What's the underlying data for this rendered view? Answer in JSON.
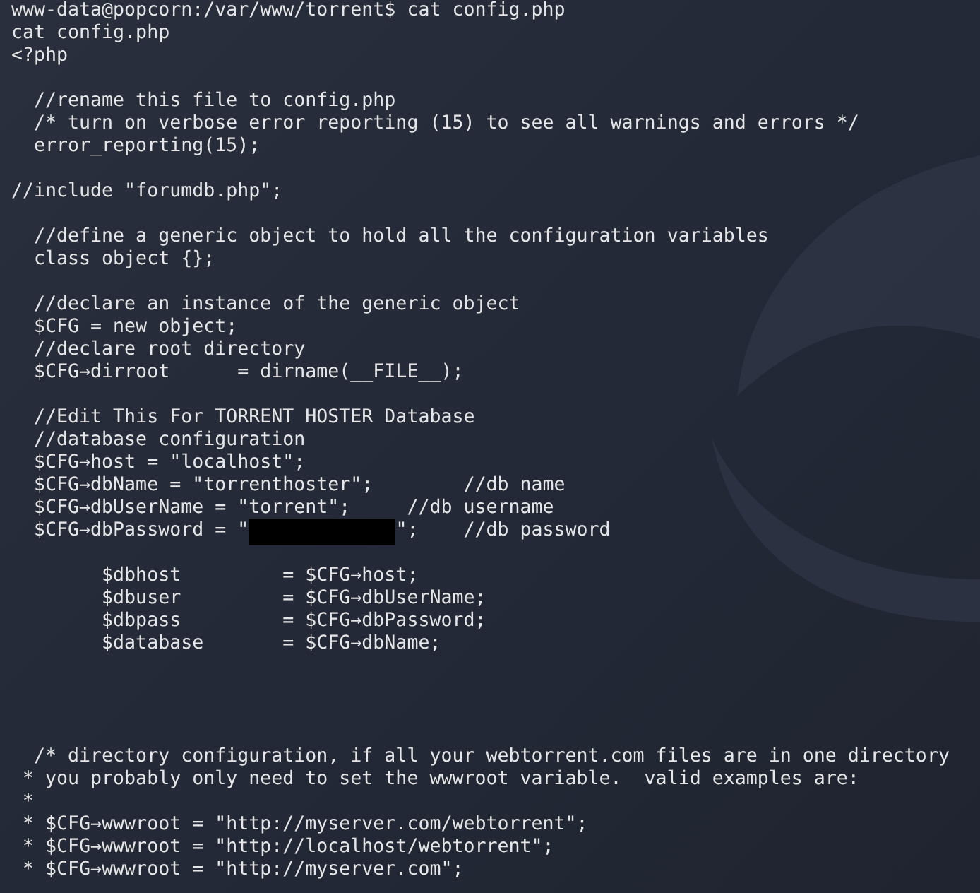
{
  "terminal": {
    "lines": [
      {
        "kind": "text",
        "text": "www-data@popcorn:/var/www/torrent$ cat config.php"
      },
      {
        "kind": "text",
        "text": "cat config.php"
      },
      {
        "kind": "text",
        "text": "<?php"
      },
      {
        "kind": "blank"
      },
      {
        "kind": "text",
        "text": "  //rename this file to config.php"
      },
      {
        "kind": "text",
        "text": "  /* turn on verbose error reporting (15) to see all warnings and errors */"
      },
      {
        "kind": "text",
        "text": "  error_reporting(15);"
      },
      {
        "kind": "blank"
      },
      {
        "kind": "text",
        "text": "//include \"forumdb.php\";"
      },
      {
        "kind": "blank"
      },
      {
        "kind": "text",
        "text": "  //define a generic object to hold all the configuration variables"
      },
      {
        "kind": "text",
        "text": "  class object {};"
      },
      {
        "kind": "blank"
      },
      {
        "kind": "text",
        "text": "  //declare an instance of the generic object"
      },
      {
        "kind": "text",
        "text": "  $CFG = new object;"
      },
      {
        "kind": "text",
        "text": "  //declare root directory"
      },
      {
        "kind": "text",
        "text": "  $CFG→dirroot      = dirname(__FILE__);"
      },
      {
        "kind": "blank"
      },
      {
        "kind": "text",
        "text": "  //Edit This For TORRENT HOSTER Database"
      },
      {
        "kind": "text",
        "text": "  //database configuration"
      },
      {
        "kind": "text",
        "text": "  $CFG→host = \"localhost\";"
      },
      {
        "kind": "text",
        "text": "  $CFG→dbName = \"torrenthoster\";        //db name"
      },
      {
        "kind": "text",
        "text": "  $CFG→dbUserName = \"torrent\";     //db username"
      },
      {
        "kind": "redacted",
        "before": "  $CFG→dbPassword = \"",
        "after": "\";    //db password"
      },
      {
        "kind": "blank"
      },
      {
        "kind": "text",
        "text": "        $dbhost         = $CFG→host;"
      },
      {
        "kind": "text",
        "text": "        $dbuser         = $CFG→dbUserName;"
      },
      {
        "kind": "text",
        "text": "        $dbpass         = $CFG→dbPassword;"
      },
      {
        "kind": "text",
        "text": "        $database       = $CFG→dbName;"
      },
      {
        "kind": "blank"
      },
      {
        "kind": "blank"
      },
      {
        "kind": "blank"
      },
      {
        "kind": "blank"
      },
      {
        "kind": "text",
        "text": "  /* directory configuration, if all your webtorrent.com files are in one directory"
      },
      {
        "kind": "text",
        "text": " * you probably only need to set the wwwroot variable.  valid examples are:"
      },
      {
        "kind": "text",
        "text": " *"
      },
      {
        "kind": "text",
        "text": " * $CFG→wwwroot = \"http://myserver.com/webtorrent\";"
      },
      {
        "kind": "text",
        "text": " * $CFG→wwwroot = \"http://localhost/webtorrent\";"
      },
      {
        "kind": "text",
        "text": " * $CFG→wwwroot = \"http://myserver.com\";"
      }
    ]
  }
}
